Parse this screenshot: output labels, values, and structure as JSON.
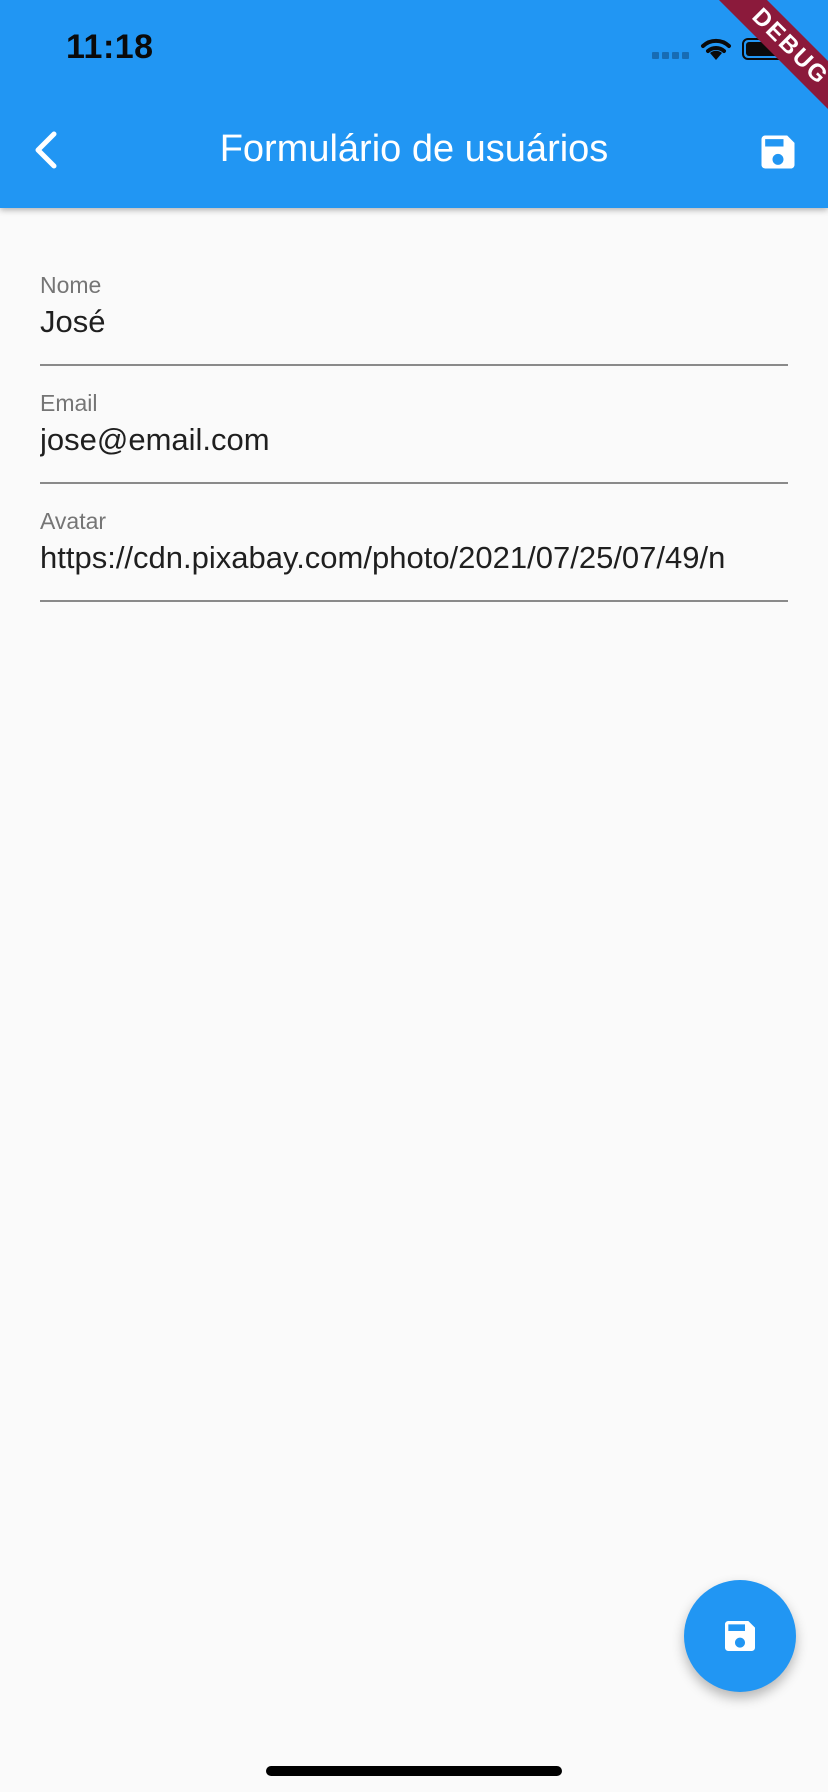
{
  "status_bar": {
    "time": "11:18"
  },
  "debug_banner": "DEBUG",
  "appbar": {
    "title": "Formulário de usuários",
    "back_icon": "chevron-left-icon",
    "action_icon": "save-icon",
    "color": "#2196f3"
  },
  "form": {
    "fields": [
      {
        "label": "Nome",
        "value": "José"
      },
      {
        "label": "Email",
        "value": "jose@email.com"
      },
      {
        "label": "Avatar",
        "value": "https://cdn.pixabay.com/photo/2021/07/25/07/49/n"
      }
    ]
  },
  "fab": {
    "icon": "save-icon",
    "color": "#2196f3"
  }
}
